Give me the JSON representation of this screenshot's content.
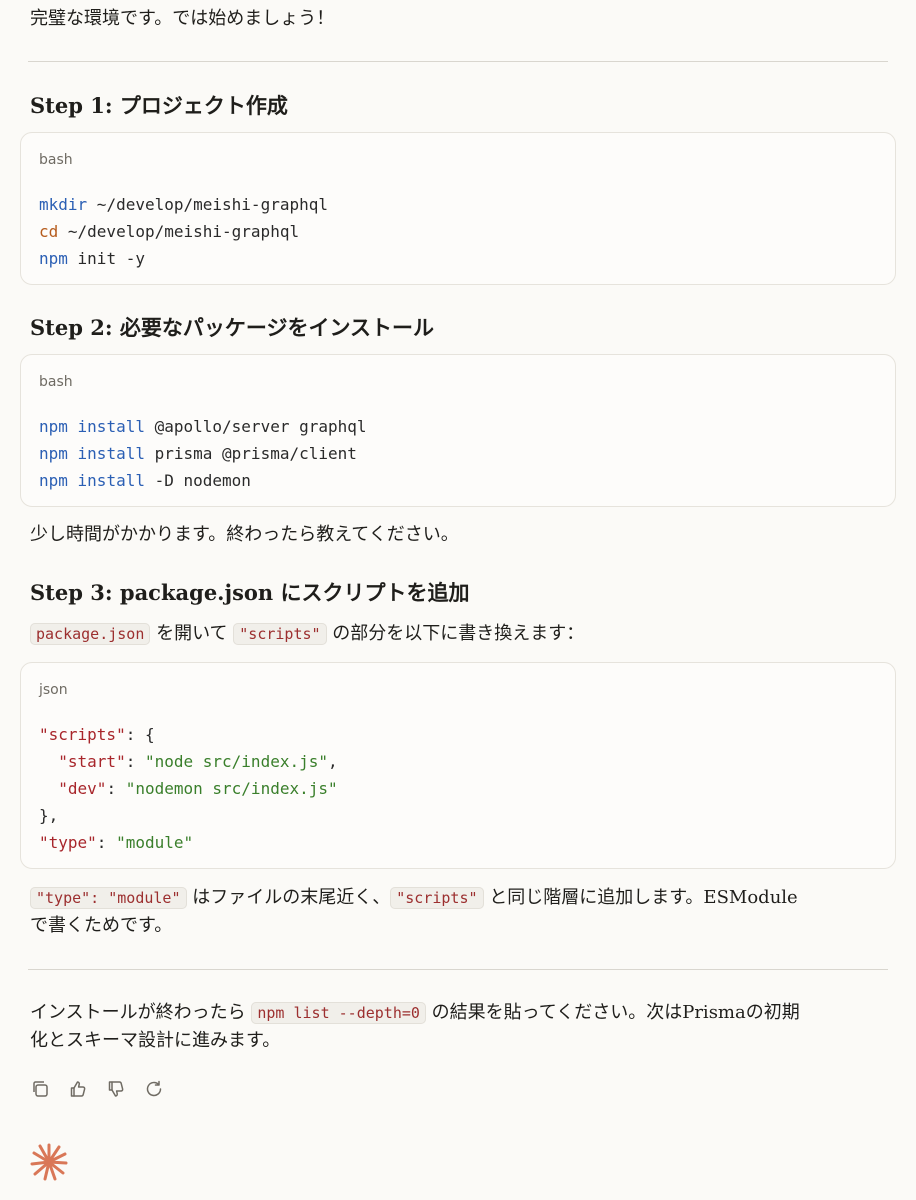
{
  "intro": "完璧な環境です。では始めましょう！",
  "steps": [
    {
      "title": "Step 1: プロジェクト作成",
      "lang": "bash",
      "lines": [
        {
          "cmd": "mkdir",
          "rest": " ~/develop/meishi-graphql"
        },
        {
          "cmd": "cd",
          "rest": " ~/develop/meishi-graphql"
        },
        {
          "cmd": "npm",
          "rest": " init -y"
        }
      ]
    },
    {
      "title": "Step 2: 必要なパッケージをインストール",
      "lang": "bash",
      "lines": [
        {
          "cmd": "npm",
          "sub": " install",
          "rest": " @apollo/server graphql"
        },
        {
          "cmd": "npm",
          "sub": " install",
          "rest": " prisma @prisma/client"
        },
        {
          "cmd": "npm",
          "sub": " install",
          "rest": " -D nodemon"
        }
      ]
    }
  ],
  "wait_text": "少し時間がかかります。終わったら教えてください。",
  "step3": {
    "title": "Step 3: package.json にスクリプトを追加",
    "desc_code1": "package.json",
    "desc_mid": " を開いて ",
    "desc_code2": "\"scripts\"",
    "desc_end": " の部分を以下に書き換えます：",
    "lang": "json",
    "json": {
      "k_scripts": "\"scripts\"",
      "brace_open": ": {",
      "k_start": "\"start\"",
      "v_start": "\"node src/index.js\"",
      "k_dev": "\"dev\"",
      "v_dev": "\"nodemon src/index.js\"",
      "brace_close": "},",
      "k_type": "\"type\"",
      "v_type": "\"module\""
    }
  },
  "note": {
    "code1": "\"type\": \"module\"",
    "mid": " はファイルの末尾近く、",
    "code2": "\"scripts\"",
    "end1": " と同じ階層に追加します。ESModule",
    "end2": "で書くためです。"
  },
  "final": {
    "pre": "インストールが終わったら ",
    "code": "npm list --depth=0",
    "post1": " の結果を貼ってください。次はPrismaの初期",
    "post2": "化とスキーマ設計に進みます。"
  },
  "actions": [
    "copy-icon",
    "thumbs-up-icon",
    "thumbs-down-icon",
    "retry-icon"
  ],
  "colors": {
    "accent": "#d97757",
    "keyword": "#2b5fb4",
    "string": "#3a7f2b",
    "key": "#a8262b"
  }
}
